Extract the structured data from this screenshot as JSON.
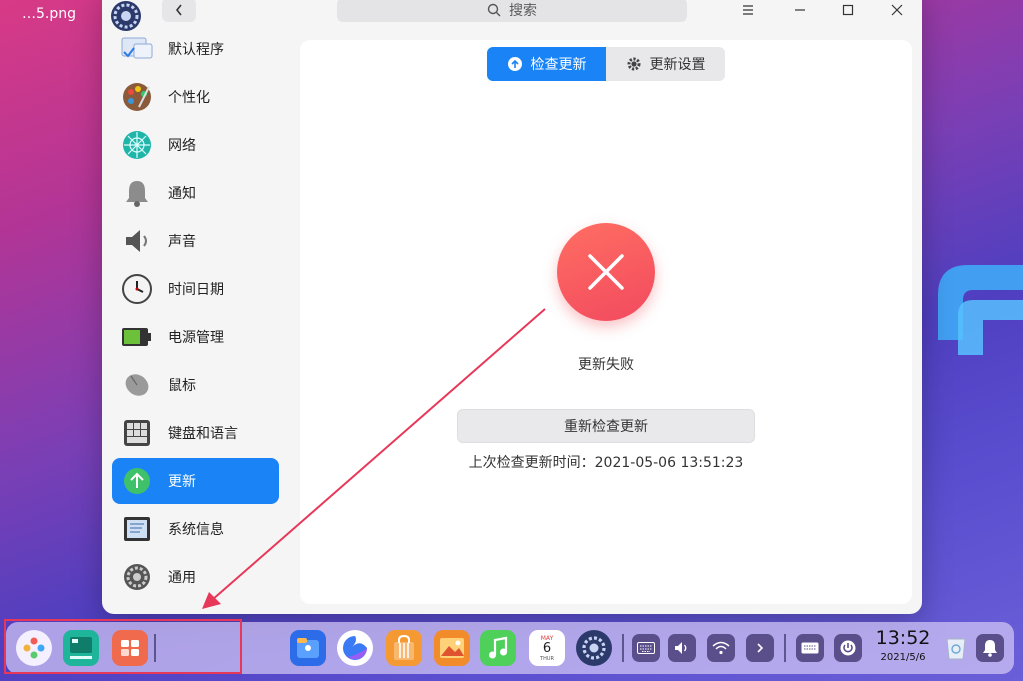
{
  "desktop": {
    "file_label": "…5.png"
  },
  "window": {
    "search_placeholder": "搜索",
    "sidebar": {
      "items": [
        {
          "label": "默认程序",
          "icon": "default-apps-icon"
        },
        {
          "label": "个性化",
          "icon": "palette-icon"
        },
        {
          "label": "网络",
          "icon": "network-icon"
        },
        {
          "label": "通知",
          "icon": "bell-icon"
        },
        {
          "label": "声音",
          "icon": "speaker-icon"
        },
        {
          "label": "时间日期",
          "icon": "clock-icon"
        },
        {
          "label": "电源管理",
          "icon": "battery-icon"
        },
        {
          "label": "鼠标",
          "icon": "mouse-icon"
        },
        {
          "label": "键盘和语言",
          "icon": "keyboard-icon"
        },
        {
          "label": "更新",
          "icon": "update-arrow-icon",
          "active": true
        },
        {
          "label": "系统信息",
          "icon": "system-info-icon"
        },
        {
          "label": "通用",
          "icon": "gear-icon"
        }
      ]
    },
    "content": {
      "tabs": [
        {
          "label": "检查更新",
          "active": true
        },
        {
          "label": "更新设置",
          "active": false
        }
      ],
      "status": "更新失败",
      "recheck_label": "重新检查更新",
      "last_check": "上次检查更新时间：2021-05-06 13:51:23"
    }
  },
  "dock": {
    "calendar": {
      "month": "MAY",
      "day": "6",
      "weekday": "THUR"
    },
    "clock": {
      "time": "13:52",
      "date": "2021/5/6"
    }
  },
  "colors": {
    "accent": "#1a84f6",
    "error": "#f24a5f",
    "annotation": "#e8385a"
  }
}
